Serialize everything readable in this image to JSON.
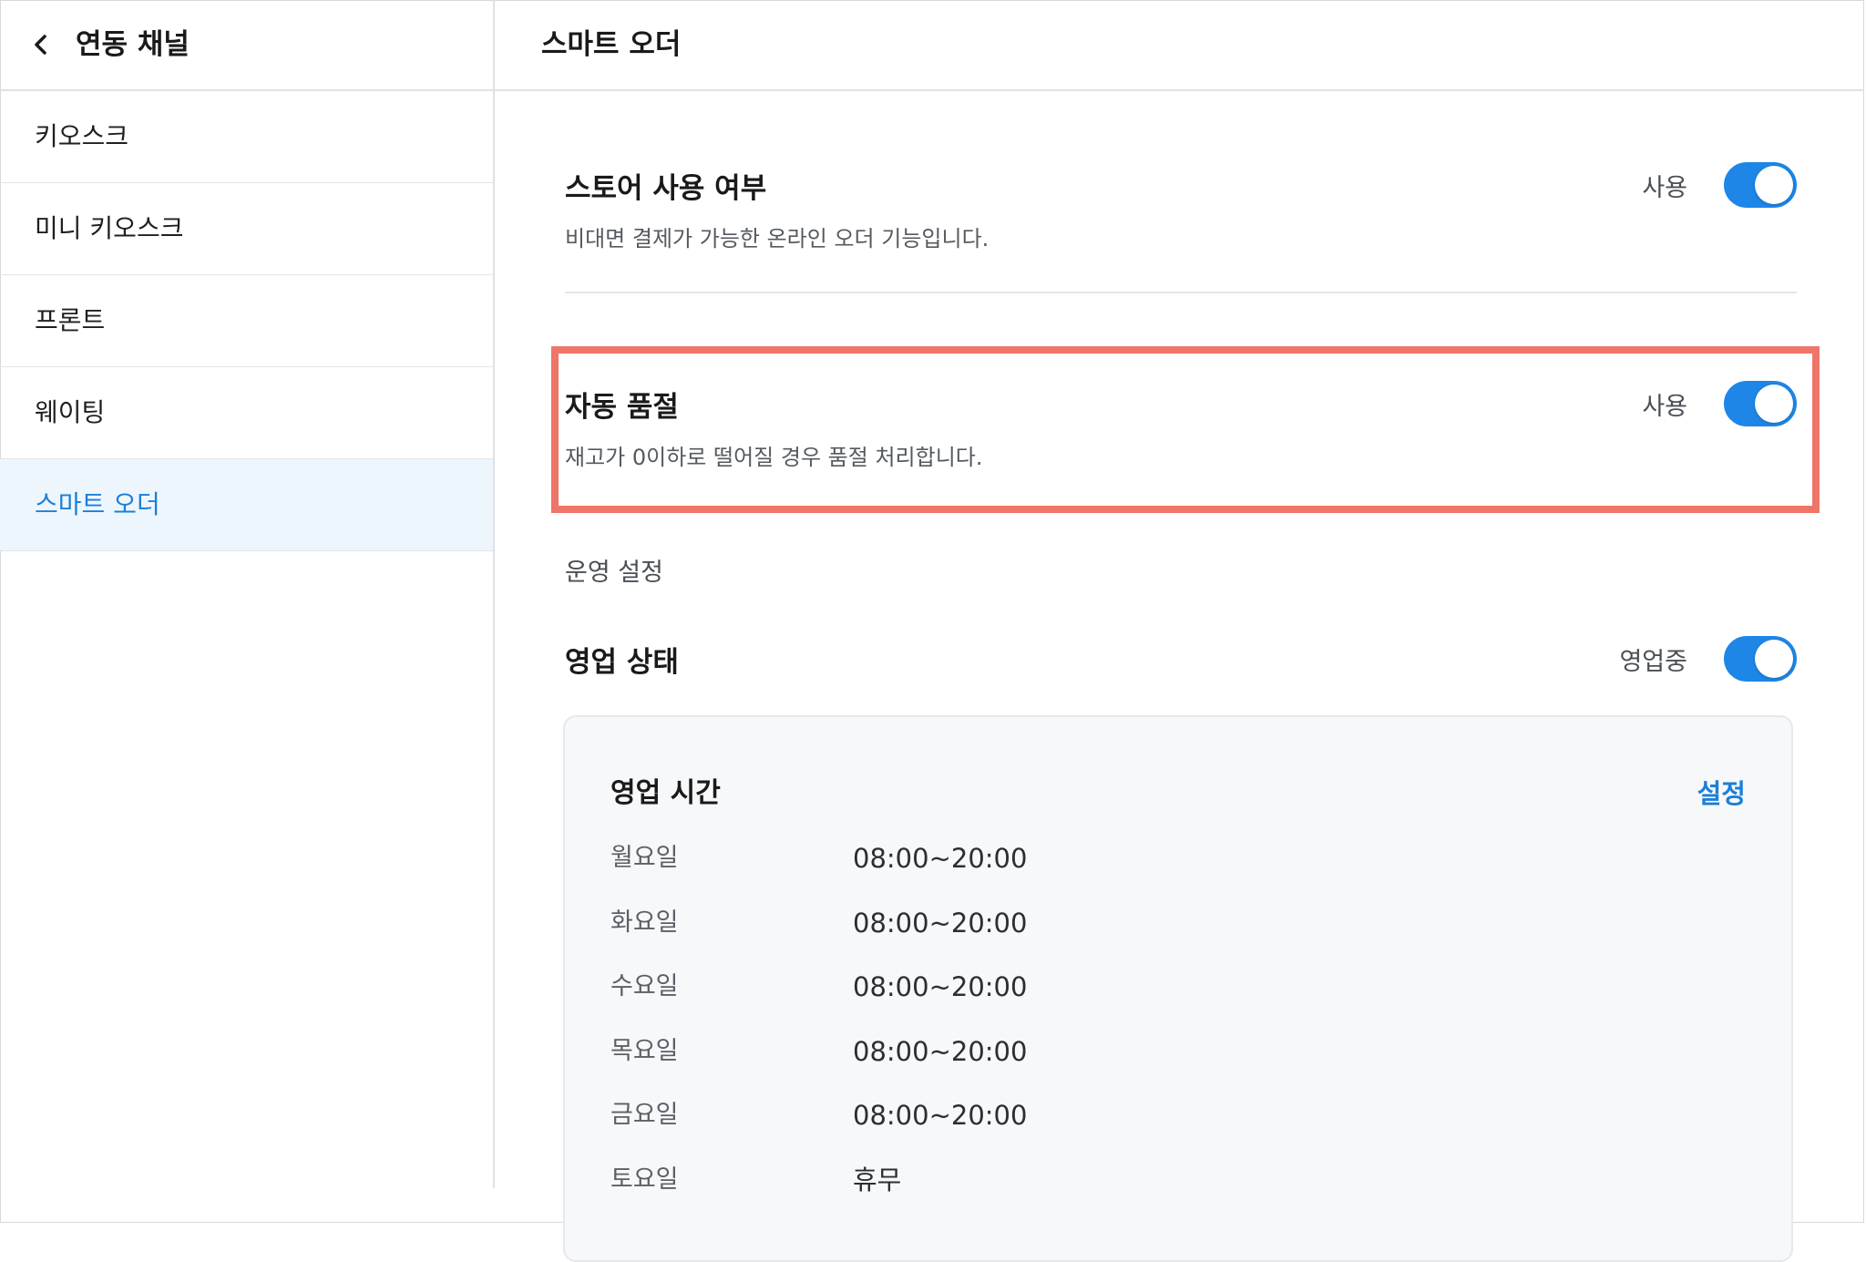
{
  "sidebar": {
    "title": "연동 채널",
    "items": [
      {
        "label": "키오스크",
        "active": false
      },
      {
        "label": "미니 키오스크",
        "active": false
      },
      {
        "label": "프론트",
        "active": false
      },
      {
        "label": "웨이팅",
        "active": false
      },
      {
        "label": "스마트 오더",
        "active": true
      }
    ]
  },
  "main": {
    "title": "스마트 오더",
    "store_usage": {
      "title": "스토어 사용 여부",
      "description": "비대면 결제가 가능한 온라인 오더 기능입니다.",
      "status": "사용",
      "enabled": true
    },
    "auto_soldout": {
      "title": "자동 품절",
      "description": "재고가 0이하로 떨어질 경우 품절 처리합니다.",
      "status": "사용",
      "enabled": true
    },
    "operation_section_label": "운영 설정",
    "business_status": {
      "title": "영업 상태",
      "status": "영업중",
      "enabled": true
    },
    "business_hours": {
      "title": "영업 시간",
      "set_label": "설정",
      "days": [
        {
          "day": "월요일",
          "time": "08:00~20:00"
        },
        {
          "day": "화요일",
          "time": "08:00~20:00"
        },
        {
          "day": "수요일",
          "time": "08:00~20:00"
        },
        {
          "day": "목요일",
          "time": "08:00~20:00"
        },
        {
          "day": "금요일",
          "time": "08:00~20:00"
        },
        {
          "day": "토요일",
          "time": "휴무"
        }
      ]
    }
  },
  "colors": {
    "accent": "#1d86e6",
    "highlight_border": "#ee7568",
    "active_bg": "#eef6fd"
  }
}
